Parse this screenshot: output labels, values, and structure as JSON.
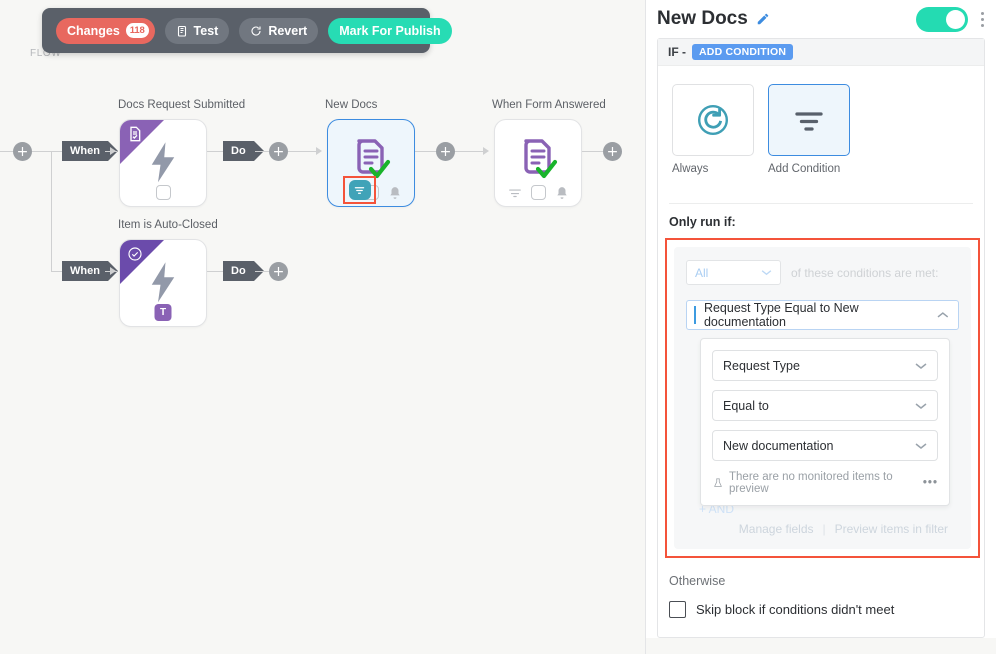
{
  "toolbar": {
    "changes_label": "Changes",
    "changes_count": "118",
    "test_label": "Test",
    "revert_label": "Revert",
    "publish_label": "Mark For Publish"
  },
  "canvas": {
    "flow_label": "FLOW",
    "when_label": "When",
    "do_label": "Do",
    "plus_label": "+",
    "nodes": [
      {
        "title": "Docs Request Submitted",
        "icon": "document-check-icon"
      },
      {
        "title": "Item is Auto-Closed",
        "icon": "circle-check-icon",
        "badge": "T"
      },
      {
        "title": "New Docs",
        "icon": "document-check-icon",
        "selected": true
      },
      {
        "title": "When Form Answered",
        "icon": "document-check-icon"
      }
    ]
  },
  "panel": {
    "title": "New Docs",
    "if_label": "IF -",
    "add_condition_chip": "ADD CONDITION",
    "modes": [
      {
        "label": "Always",
        "icon": "refresh-icon",
        "active": false
      },
      {
        "label": "Add Condition",
        "icon": "filter-icon",
        "active": true
      }
    ],
    "only_run_if": "Only run if:",
    "all_select_value": "All",
    "conditions_tail": "of these conditions are met:",
    "condition_summary": "Request Type Equal to New documentation",
    "dropdown": {
      "field": "Request Type",
      "operator": "Equal to",
      "value": "New documentation",
      "note": "There are no monitored items to preview",
      "more_dots": "•••"
    },
    "and_label": "+ AND",
    "manage_fields": "Manage fields",
    "links_separator": "|",
    "preview_items": "Preview items in filter",
    "otherwise_label": "Otherwise",
    "skip_label": "Skip block if conditions didn't meet"
  }
}
